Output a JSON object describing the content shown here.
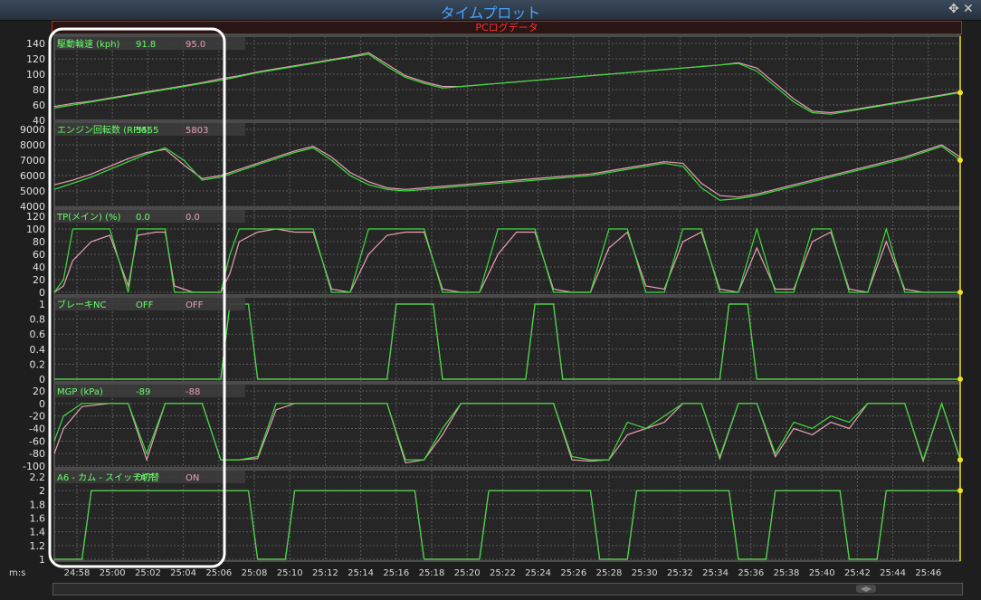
{
  "window": {
    "title": "タイムプロット",
    "source_label": "PCログデータ",
    "move_icon": "move-icon",
    "close_icon": "close-icon"
  },
  "x_axis": {
    "unit_label": "m:s",
    "ticks": [
      "24:58",
      "25:00",
      "25:02",
      "25:04",
      "25:06",
      "25:08",
      "25:10",
      "25:12",
      "25:14",
      "25:16",
      "25:18",
      "25:20",
      "25:22",
      "25:24",
      "25:26",
      "25:28",
      "25:30",
      "25:32",
      "25:34",
      "25:36",
      "25:38",
      "25:40",
      "25:42",
      "25:44",
      "25:46"
    ]
  },
  "colors": {
    "series_a": "#3cdc3c",
    "series_b": "#e8a0b4",
    "grid": "#5a5a5a",
    "cursor": "#f0e020",
    "highlight": "#ffffff",
    "label_text": "#66ff66"
  },
  "chart_data": [
    {
      "type": "line",
      "name": "speed",
      "label": "駆動輪速 (kph)",
      "val_a": "91.8",
      "val_b": "95.0",
      "ylim": [
        40,
        140
      ],
      "yticks": [
        "40",
        "60",
        "80",
        "100",
        "120",
        "140"
      ],
      "x": [
        0,
        2,
        4,
        6,
        8,
        10,
        12,
        14,
        16,
        18,
        20,
        22,
        24,
        26,
        28,
        30,
        32,
        34,
        36,
        38,
        40,
        42,
        44,
        46,
        48,
        50,
        52,
        54,
        56,
        58,
        60,
        62,
        64,
        66,
        68,
        70,
        72,
        74,
        76,
        78,
        80,
        82,
        84,
        86,
        88,
        90,
        92,
        94,
        96,
        98
      ],
      "series": [
        {
          "values": [
            56,
            60,
            64,
            68,
            72,
            76,
            80,
            84,
            88,
            92,
            97,
            102,
            106,
            110,
            114,
            118,
            122,
            126,
            110,
            96,
            88,
            82,
            84,
            86,
            88,
            90,
            92,
            94,
            96,
            98,
            100,
            102,
            104,
            106,
            108,
            110,
            112,
            114,
            104,
            84,
            64,
            50,
            48,
            52,
            56,
            60,
            64,
            68,
            72,
            76
          ]
        },
        {
          "values": [
            58,
            62,
            65,
            69,
            73,
            77,
            81,
            85,
            89,
            94,
            98,
            103,
            107,
            111,
            115,
            119,
            123,
            128,
            113,
            98,
            90,
            84,
            84,
            86,
            88,
            90,
            92,
            94,
            96,
            98,
            100,
            102,
            104,
            106,
            108,
            110,
            112,
            115,
            108,
            88,
            68,
            52,
            50,
            53,
            57,
            61,
            65,
            69,
            73,
            77
          ]
        }
      ]
    },
    {
      "type": "line",
      "name": "rpm",
      "label": "エンジン回転数 (RPM)",
      "val_a": "5555",
      "val_b": "5803",
      "ylim": [
        4000,
        9000
      ],
      "yticks": [
        "4000",
        "5000",
        "6000",
        "7000",
        "8000",
        "9000"
      ],
      "x": [
        0,
        2,
        4,
        6,
        8,
        10,
        12,
        14,
        16,
        18,
        20,
        22,
        24,
        26,
        28,
        30,
        32,
        34,
        36,
        38,
        40,
        42,
        44,
        46,
        48,
        50,
        52,
        54,
        56,
        58,
        60,
        62,
        64,
        66,
        68,
        70,
        72,
        74,
        76,
        78,
        80,
        82,
        84,
        86,
        88,
        90,
        92,
        94,
        96,
        98
      ],
      "series": [
        {
          "values": [
            5100,
            5500,
            5900,
            6400,
            6900,
            7400,
            7800,
            7000,
            5700,
            5900,
            6300,
            6700,
            7100,
            7500,
            7800,
            7000,
            6000,
            5400,
            5100,
            5000,
            5100,
            5200,
            5300,
            5400,
            5500,
            5600,
            5700,
            5800,
            5900,
            6000,
            6200,
            6400,
            6600,
            6800,
            6600,
            5200,
            4400,
            4500,
            4700,
            5000,
            5300,
            5600,
            5900,
            6200,
            6500,
            6800,
            7100,
            7500,
            7900,
            7000
          ]
        },
        {
          "values": [
            5400,
            5700,
            6100,
            6600,
            7100,
            7500,
            7700,
            6700,
            5800,
            6000,
            6400,
            6800,
            7200,
            7600,
            7900,
            7200,
            6200,
            5600,
            5200,
            5100,
            5200,
            5300,
            5400,
            5500,
            5600,
            5700,
            5800,
            5900,
            6000,
            6100,
            6300,
            6500,
            6700,
            6900,
            6800,
            5500,
            4700,
            4600,
            4800,
            5100,
            5400,
            5700,
            6000,
            6300,
            6600,
            6900,
            7200,
            7600,
            8000,
            7200
          ]
        }
      ]
    },
    {
      "type": "line",
      "name": "tp",
      "label": "TP(メイン) (%)",
      "val_a": "0.0",
      "val_b": "0.0",
      "ylim": [
        0,
        120
      ],
      "yticks": [
        "0",
        "20",
        "40",
        "60",
        "80",
        "100",
        "120"
      ],
      "x": [
        0,
        1,
        2,
        4,
        6,
        8,
        9,
        11,
        12,
        13,
        15,
        18,
        19,
        20,
        22,
        24,
        26,
        28,
        30,
        32,
        34,
        36,
        38,
        40,
        42,
        44,
        46,
        48,
        50,
        52,
        54,
        56,
        58,
        60,
        62,
        64,
        66,
        68,
        70,
        72,
        74,
        76,
        78,
        80,
        82,
        84,
        86,
        88,
        90,
        92,
        94,
        96,
        98
      ],
      "series": [
        {
          "values": [
            0,
            20,
            100,
            100,
            100,
            0,
            100,
            100,
            100,
            0,
            0,
            0,
            60,
            100,
            100,
            100,
            100,
            100,
            0,
            0,
            100,
            100,
            100,
            100,
            0,
            0,
            0,
            100,
            100,
            100,
            0,
            0,
            0,
            100,
            100,
            0,
            0,
            100,
            100,
            0,
            0,
            100,
            0,
            0,
            100,
            100,
            0,
            0,
            100,
            0,
            0,
            0,
            0
          ]
        },
        {
          "values": [
            0,
            10,
            50,
            80,
            90,
            10,
            90,
            95,
            95,
            10,
            0,
            0,
            30,
            80,
            95,
            100,
            95,
            95,
            5,
            0,
            60,
            90,
            95,
            95,
            5,
            0,
            0,
            60,
            95,
            95,
            5,
            0,
            0,
            70,
            95,
            10,
            5,
            80,
            95,
            5,
            0,
            70,
            5,
            5,
            80,
            95,
            5,
            0,
            80,
            5,
            0,
            0,
            0
          ]
        }
      ]
    },
    {
      "type": "line",
      "name": "brake",
      "label": "ブレーキNC",
      "val_a": "OFF",
      "val_b": "OFF",
      "ylim": [
        0,
        1
      ],
      "yticks": [
        "0",
        "0.2",
        "0.4",
        "0.6",
        "0.8",
        "1"
      ],
      "x": [
        0,
        18,
        19,
        21,
        22,
        26,
        36,
        37,
        41,
        42,
        51,
        52,
        54,
        55,
        72,
        73,
        75,
        76,
        98
      ],
      "series": [
        {
          "values": [
            0,
            0,
            1,
            1,
            0,
            0,
            0,
            1,
            1,
            0,
            0,
            1,
            1,
            0,
            0,
            1,
            1,
            0,
            0
          ]
        },
        {
          "values": [
            0,
            0,
            1,
            1,
            0,
            0,
            0,
            1,
            1,
            0,
            0,
            1,
            1,
            0,
            0,
            1,
            1,
            0,
            0
          ]
        }
      ]
    },
    {
      "type": "line",
      "name": "mgp",
      "label": "MGP (kPa)",
      "val_a": "-89",
      "val_b": "-88",
      "ylim": [
        -100,
        20
      ],
      "yticks": [
        "-100",
        "-80",
        "-60",
        "-40",
        "-20",
        "0",
        "20"
      ],
      "x": [
        0,
        1,
        3,
        6,
        8,
        10,
        12,
        14,
        16,
        18,
        20,
        22,
        24,
        26,
        28,
        30,
        32,
        34,
        36,
        38,
        40,
        42,
        44,
        46,
        48,
        50,
        52,
        54,
        56,
        58,
        60,
        62,
        64,
        66,
        68,
        70,
        72,
        74,
        76,
        78,
        80,
        82,
        84,
        86,
        88,
        90,
        92,
        94,
        96,
        98
      ],
      "series": [
        {
          "values": [
            -60,
            -20,
            0,
            0,
            0,
            -80,
            0,
            0,
            0,
            -90,
            -90,
            -85,
            0,
            0,
            0,
            0,
            0,
            0,
            0,
            -90,
            -90,
            -40,
            0,
            0,
            0,
            0,
            0,
            0,
            -85,
            -90,
            -90,
            -30,
            -40,
            -20,
            0,
            0,
            -85,
            0,
            0,
            -80,
            -30,
            -40,
            -20,
            -30,
            0,
            0,
            0,
            -90,
            0,
            -90
          ]
        },
        {
          "values": [
            -80,
            -40,
            -5,
            0,
            0,
            -90,
            0,
            0,
            0,
            -90,
            -90,
            -88,
            -10,
            0,
            0,
            0,
            0,
            0,
            0,
            -95,
            -90,
            -50,
            0,
            0,
            0,
            0,
            0,
            0,
            -90,
            -92,
            -90,
            -50,
            -40,
            -30,
            0,
            0,
            -88,
            0,
            0,
            -85,
            -40,
            -50,
            -30,
            -40,
            0,
            0,
            0,
            -92,
            0,
            -88
          ]
        }
      ]
    },
    {
      "type": "line",
      "name": "cam",
      "label": "A6 - カム - スイッチ切替",
      "val_a": "OFF",
      "val_b": "ON",
      "ylim": [
        1,
        2.2
      ],
      "yticks": [
        "1",
        "1.2",
        "1.4",
        "1.6",
        "1.8",
        "2",
        "2.2"
      ],
      "x": [
        0,
        3,
        4,
        21,
        22,
        25,
        26,
        39,
        40,
        46,
        47,
        58,
        59,
        62,
        63,
        73,
        74,
        77,
        78,
        85,
        86,
        89,
        90,
        98
      ],
      "series": [
        {
          "values": [
            1,
            1,
            2,
            2,
            1,
            1,
            2,
            2,
            1,
            1,
            2,
            2,
            1,
            1,
            2,
            2,
            1,
            1,
            2,
            2,
            1,
            1,
            2,
            2
          ]
        },
        {
          "values": [
            1,
            1,
            2,
            2,
            1,
            1,
            2,
            2,
            1,
            1,
            2,
            2,
            1,
            1,
            2,
            2,
            1,
            1,
            2,
            2,
            1,
            1,
            2,
            2
          ]
        }
      ]
    }
  ]
}
